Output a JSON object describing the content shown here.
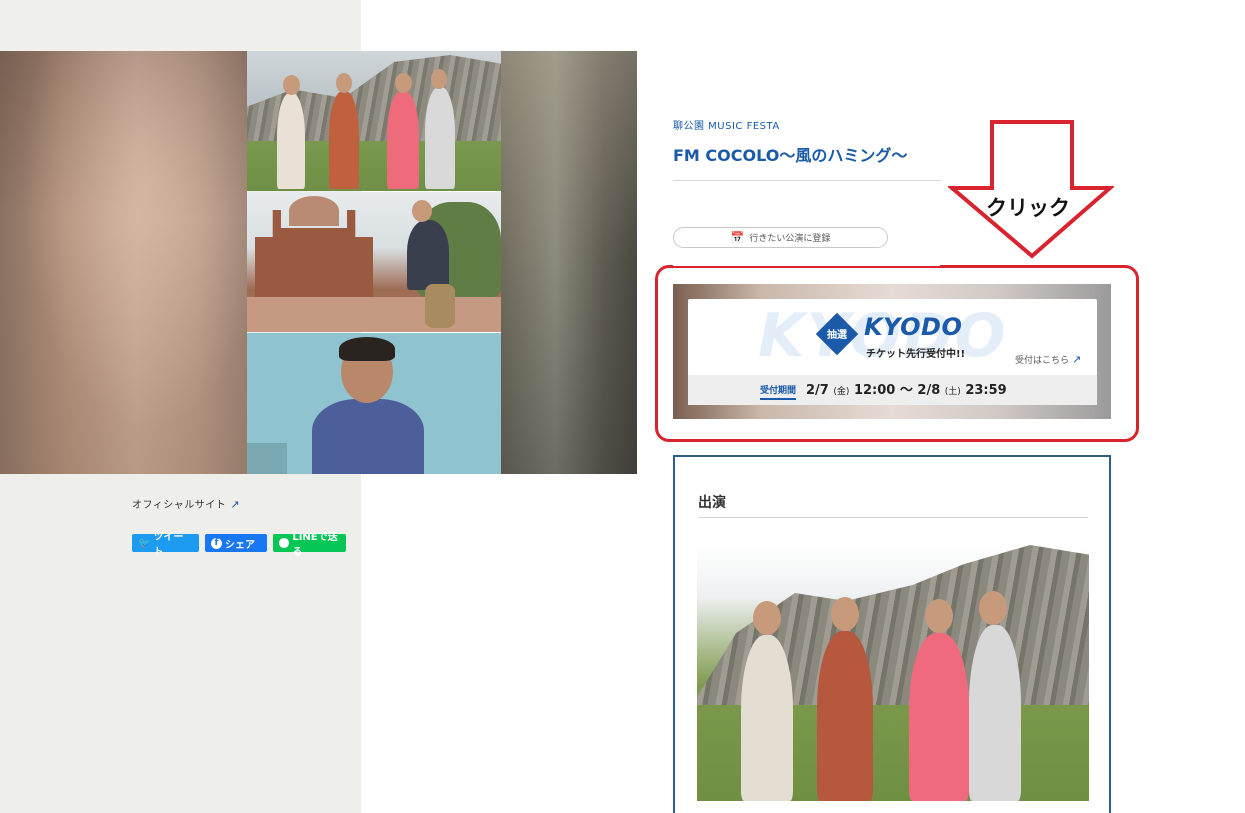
{
  "left": {
    "official_site": "オフィシャルサイト",
    "share": {
      "tweet": "ツイート",
      "facebook": "シェア",
      "line": "LINEで送る"
    }
  },
  "event": {
    "category": "聊公園 MUSIC FESTA",
    "title": "FM COCOLO〜風のハミング〜",
    "register_label": "行きたい公演に登録"
  },
  "banner": {
    "watermark": "KYODO",
    "lottery": "抽選",
    "brand": "KYODO",
    "presale": "チケット先行受付中!!",
    "accept_link": "受付はこちら",
    "period_label": "受付期間",
    "start_date": "2/7",
    "start_day": "(金)",
    "start_time": "12:00",
    "separator": "〜",
    "end_date": "2/8",
    "end_day": "(土)",
    "end_time": "23:59"
  },
  "annotation": {
    "click_label": "クリック",
    "arrow_color": "#d9232e",
    "highlight_color": "#d9232e"
  },
  "cast": {
    "title": "出演"
  },
  "colors": {
    "accent": "#1a5aa8",
    "twitter": "#1d9bf0",
    "facebook": "#1877f2",
    "line": "#06c755"
  },
  "icons": {
    "external": "external-link-icon",
    "calendar": "calendar-heart-icon",
    "twitter": "twitter-bird-icon",
    "facebook": "facebook-icon",
    "line": "line-icon"
  }
}
